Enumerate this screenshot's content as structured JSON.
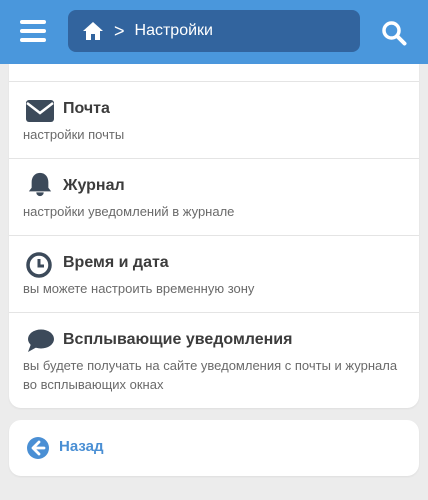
{
  "header": {
    "breadcrumb_current": "Настройки",
    "breadcrumb_separator": ">",
    "accent_color": "#4a97dc",
    "crumb_bg_color": "#32649e"
  },
  "settings": [
    {
      "icon": "envelope-icon",
      "title": "Почта",
      "description": "настройки почты"
    },
    {
      "icon": "bell-icon",
      "title": "Журнал",
      "description": "настройки уведомлений в журнале"
    },
    {
      "icon": "clock-icon",
      "title": "Время и дата",
      "description": "вы можете настроить временную зону"
    },
    {
      "icon": "chat-bubble-icon",
      "title": "Всплывающие уведомления",
      "description": "вы будете получать на сайте уведомления с почты и журнала во всплывающих окнах"
    }
  ],
  "back": {
    "label": "Назад",
    "icon": "arrow-left-circle-icon"
  }
}
